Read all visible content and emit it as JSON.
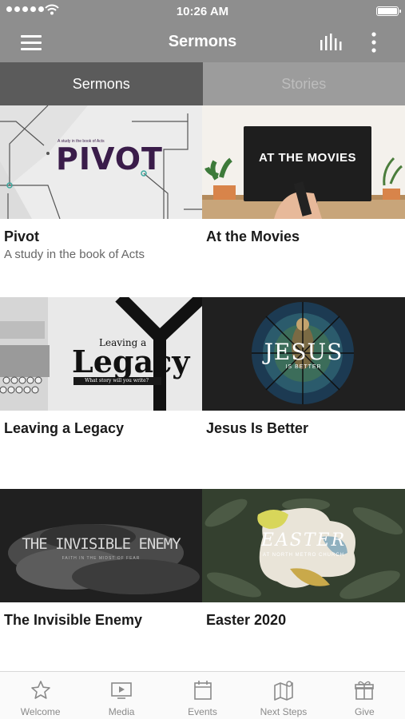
{
  "status_bar": {
    "time": "10:26 AM"
  },
  "nav": {
    "title": "Sermons"
  },
  "tabs": [
    {
      "label": "Sermons",
      "active": true
    },
    {
      "label": "Stories",
      "active": false
    }
  ],
  "sermons": [
    {
      "title": "Pivot",
      "subtitle": "A study in the book of Acts",
      "art": {
        "small": "A study in the book of Acts",
        "big": "PIVOT"
      }
    },
    {
      "title": "At the Movies",
      "subtitle": "",
      "art": {
        "small": "",
        "big": "AT THE MOVIES"
      }
    },
    {
      "title": "Leaving a Legacy",
      "subtitle": "",
      "art": {
        "small": "Leaving a",
        "big": "Legacy",
        "tagline": "What story will you write?"
      }
    },
    {
      "title": "Jesus Is Better",
      "subtitle": "",
      "art": {
        "small": "",
        "big": "JESUS",
        "tagline": "IS BETTER"
      }
    },
    {
      "title": "The Invisible Enemy",
      "subtitle": "",
      "art": {
        "small": "",
        "big": "THE INVISIBLE ENEMY",
        "tagline": "FAITH IN THE MIDST OF FEAR"
      }
    },
    {
      "title": "Easter 2020",
      "subtitle": "",
      "art": {
        "small": "",
        "big": "EASTER",
        "tagline": "AT NORTH METRO CHURCH"
      }
    }
  ],
  "tab_bar": [
    {
      "label": "Welcome",
      "icon": "star-icon"
    },
    {
      "label": "Media",
      "icon": "tv-icon"
    },
    {
      "label": "Events",
      "icon": "calendar-icon"
    },
    {
      "label": "Next Steps",
      "icon": "map-icon"
    },
    {
      "label": "Give",
      "icon": "gift-icon"
    }
  ],
  "colors": {
    "header": "#8e8e8e",
    "tab_active": "#5b5b5b",
    "tab_inactive": "#9c9c9c",
    "pivot_text": "#3a1c4a"
  }
}
